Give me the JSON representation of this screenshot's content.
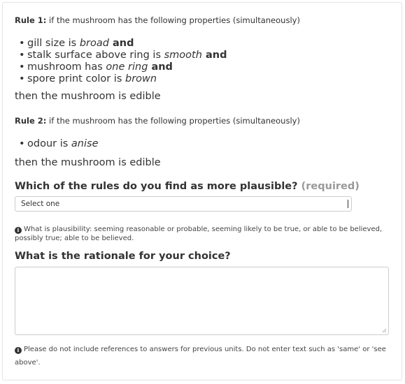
{
  "rule1": {
    "title": "Rule 1:",
    "intro": " if the mushroom has the following properties (simultaneously)",
    "items": [
      {
        "text": "gill size is ",
        "value": "broad",
        "suffix": " and"
      },
      {
        "text": "stalk surface above ring is ",
        "value": "smooth",
        "suffix": " and"
      },
      {
        "text": "mushroom has ",
        "value": "one ring",
        "suffix": " and"
      },
      {
        "text": "spore print color is ",
        "value": "brown",
        "suffix": ""
      }
    ],
    "conclusion": "then the mushroom is edible"
  },
  "rule2": {
    "title": "Rule 2:",
    "intro": " if the mushroom has the following properties (simultaneously)",
    "items": [
      {
        "text": "odour is ",
        "value": "anise",
        "suffix": ""
      }
    ],
    "conclusion": "then the mushroom is edible"
  },
  "question1": {
    "label": "Which of the rules do you find as more plausible?",
    "required": "(required)",
    "select_value": "Select one"
  },
  "note1": {
    "text": "What is plausibility: seeming reasonable or probable, seeming likely to be true, or able to be believed, possibly true; able to be believed."
  },
  "question2": {
    "label": "What is the rationale for your choice?"
  },
  "note2": {
    "text": "Please do not include references to answers for previous units. Do not enter text such as 'same' or 'see above'."
  }
}
